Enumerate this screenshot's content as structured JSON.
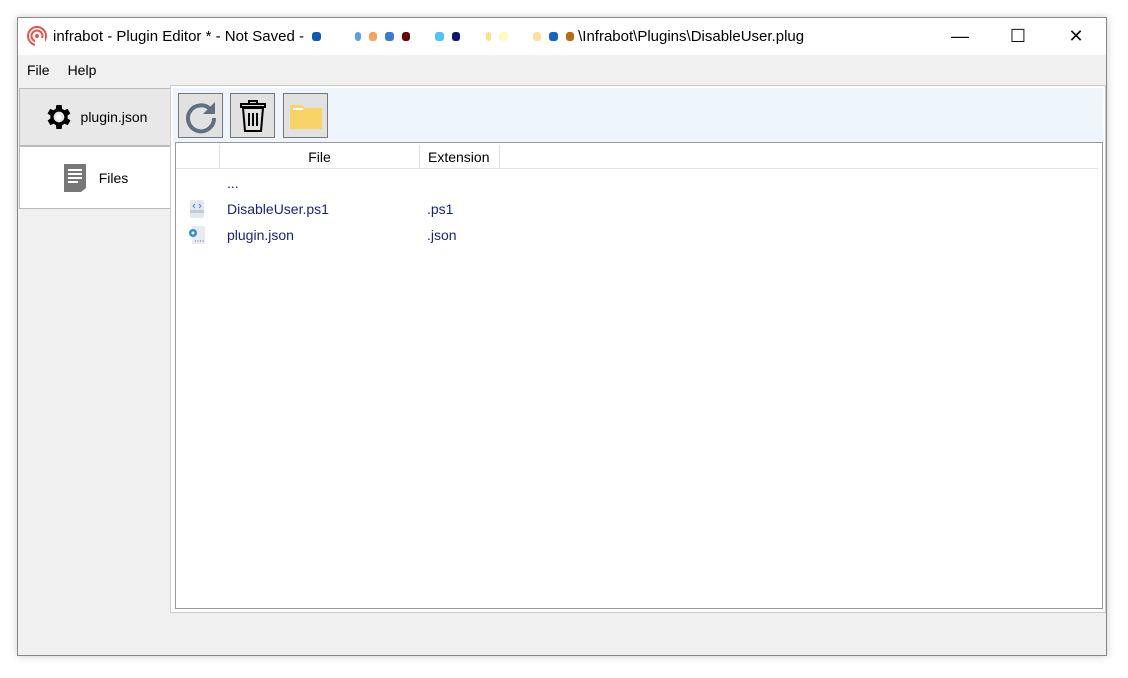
{
  "window": {
    "title_prefix": "infrabot - Plugin Editor * - Not Saved - ",
    "title_suffix": "\\Infrabot\\Plugins\\DisableUser.plug",
    "minimize": "—",
    "maximize": "☐",
    "close": "✕"
  },
  "menu": [
    "File",
    "Help"
  ],
  "tabs": [
    {
      "label": "plugin.json",
      "icon": "gear-icon"
    },
    {
      "label": "Files",
      "icon": "document-icon"
    }
  ],
  "toolbar": [
    {
      "name": "refresh-button",
      "icon": "refresh-icon"
    },
    {
      "name": "delete-button",
      "icon": "trash-icon"
    },
    {
      "name": "open-folder-button",
      "icon": "folder-icon"
    }
  ],
  "list": {
    "columns": [
      "",
      "File",
      "Extension"
    ],
    "rows": [
      {
        "file": "...",
        "ext": ""
      },
      {
        "file": "DisableUser.ps1",
        "ext": ".ps1"
      },
      {
        "file": "plugin.json",
        "ext": ".json"
      }
    ]
  },
  "colors": {
    "accent": "#eef5fd",
    "link": "#1a237e"
  }
}
